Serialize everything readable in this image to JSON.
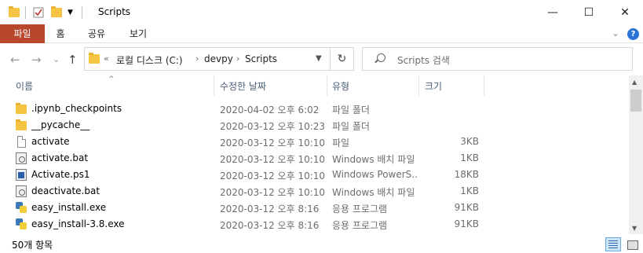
{
  "window": {
    "title": "Scripts",
    "minimize": "—",
    "maximize": "☐",
    "close": "✕"
  },
  "ribbon": {
    "tabs": [
      "파일",
      "홈",
      "공유",
      "보기"
    ],
    "expand": "⌄",
    "help": "?"
  },
  "nav": {
    "back": "←",
    "forward": "→",
    "recent": "⌄",
    "up": "↑",
    "overflow": "«",
    "breadcrumb": [
      "로컬 디스크 (C:)",
      "devpy",
      "Scripts"
    ],
    "refresh": "↻"
  },
  "search": {
    "placeholder": "Scripts 검색"
  },
  "columns": {
    "name": "이름",
    "date": "수정한 날짜",
    "type": "유형",
    "size": "크기"
  },
  "files": [
    {
      "name": ".ipynb_checkpoints",
      "date": "2020-04-02 오후 6:02",
      "type": "파일 폴더",
      "size": "",
      "icon": "folder-icon"
    },
    {
      "name": "__pycache__",
      "date": "2020-03-12 오후 10:23",
      "type": "파일 폴더",
      "size": "",
      "icon": "folder-icon"
    },
    {
      "name": "activate",
      "date": "2020-03-12 오후 10:10",
      "type": "파일",
      "size": "3KB",
      "icon": "file-icon"
    },
    {
      "name": "activate.bat",
      "date": "2020-03-12 오후 10:10",
      "type": "Windows 배치 파일",
      "size": "1KB",
      "icon": "batch-file-icon"
    },
    {
      "name": "Activate.ps1",
      "date": "2020-03-12 오후 10:10",
      "type": "Windows PowerS...",
      "size": "18KB",
      "icon": "powershell-file-icon"
    },
    {
      "name": "deactivate.bat",
      "date": "2020-03-12 오후 10:10",
      "type": "Windows 배치 파일",
      "size": "1KB",
      "icon": "batch-file-icon"
    },
    {
      "name": "easy_install.exe",
      "date": "2020-03-12 오후 8:16",
      "type": "응용 프로그램",
      "size": "91KB",
      "icon": "python-exe-icon"
    },
    {
      "name": "easy_install-3.8.exe",
      "date": "2020-03-12 오후 8:16",
      "type": "응용 프로그램",
      "size": "91KB",
      "icon": "python-exe-icon"
    }
  ],
  "status": {
    "item_count": "50개 항목"
  },
  "colors": {
    "file_tab": "#b8472c",
    "folder": "#f5c542",
    "header_text": "#4c607a"
  }
}
